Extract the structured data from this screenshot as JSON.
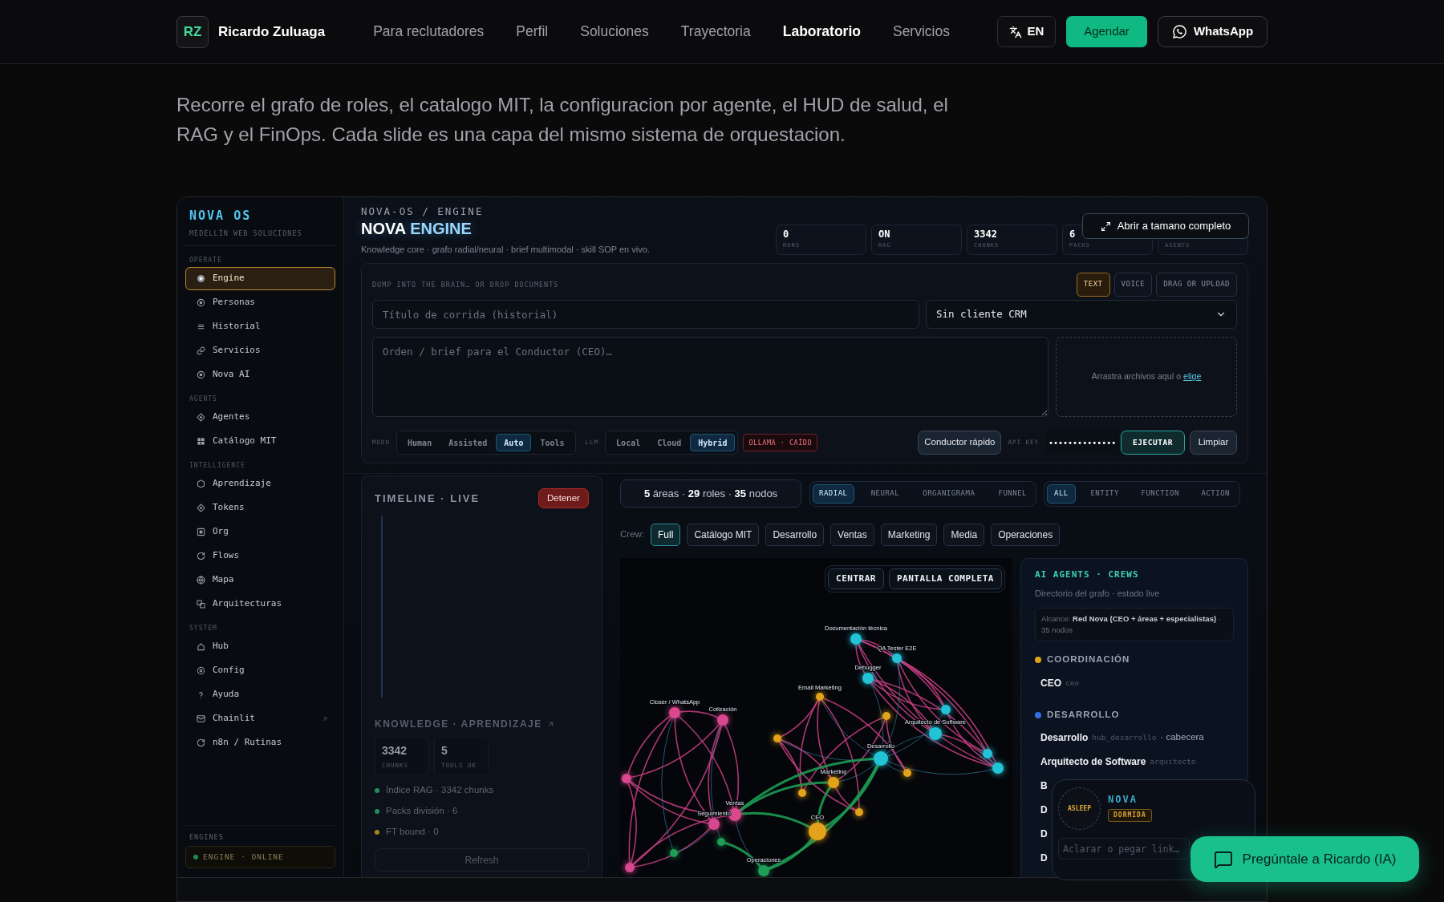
{
  "nav": {
    "initials": "RZ",
    "name": "Ricardo Zuluaga",
    "links": [
      {
        "label": "Para reclutadores",
        "selected": false
      },
      {
        "label": "Perfil",
        "selected": false
      },
      {
        "label": "Soluciones",
        "selected": false
      },
      {
        "label": "Trayectoria",
        "selected": false
      },
      {
        "label": "Laboratorio",
        "selected": true
      },
      {
        "label": "Servicios",
        "selected": false
      }
    ],
    "language": "EN",
    "cta": "Agendar",
    "whatsapp": "WhatsApp"
  },
  "intro": "Recorre el grafo de roles, el catalogo MIT, la configuracion por agente, el HUD de salud, el RAG y el FinOps. Cada slide es una capa del mismo sistema de orquestacion.",
  "expand_button": "Abrir a tamano completo",
  "sidebar": {
    "title": "NOVA OS",
    "subtitle": "MEDELLÍN WEB SOLUCIONES",
    "sections": [
      {
        "heading": "OPERATE",
        "items": [
          {
            "label": "Engine",
            "selected": true,
            "external": false
          },
          {
            "label": "Personas",
            "selected": false,
            "external": false
          },
          {
            "label": "Historial",
            "selected": false,
            "external": false
          },
          {
            "label": "Servicios",
            "selected": false,
            "external": false
          },
          {
            "label": "Nova AI",
            "selected": false,
            "external": false
          }
        ]
      },
      {
        "heading": "AGENTS",
        "items": [
          {
            "label": "Agentes",
            "selected": false,
            "external": false
          },
          {
            "label": "Catálogo MIT",
            "selected": false,
            "external": false
          }
        ]
      },
      {
        "heading": "INTELLIGENCE",
        "items": [
          {
            "label": "Aprendizaje",
            "selected": false,
            "external": false
          },
          {
            "label": "Tokens",
            "selected": false,
            "external": false
          },
          {
            "label": "Org",
            "selected": false,
            "external": false
          },
          {
            "label": "Flows",
            "selected": false,
            "external": false
          },
          {
            "label": "Mapa",
            "selected": false,
            "external": false
          },
          {
            "label": "Arquitecturas",
            "selected": false,
            "external": false
          }
        ]
      },
      {
        "heading": "SYSTEM",
        "items": [
          {
            "label": "Hub",
            "selected": false,
            "external": false
          },
          {
            "label": "Config",
            "selected": false,
            "external": false
          },
          {
            "label": "Ayuda",
            "selected": false,
            "external": false
          },
          {
            "label": "Chainlit",
            "selected": false,
            "external": true
          },
          {
            "label": "n8n / Rutinas",
            "selected": false,
            "external": false
          }
        ]
      }
    ],
    "footer": {
      "heading": "ENGINES",
      "status": "ENGINE · ONLINE"
    }
  },
  "engine": {
    "breadcrumb": "NOVA-OS / ENGINE",
    "title": "NOVA",
    "title_accent": "ENGINE",
    "subtitle": "Knowledge core · grafo radial/neural · brief multimodal · skill SOP en vivo.",
    "stats": [
      {
        "value": "0",
        "label": "RUNS"
      },
      {
        "value": "ON",
        "label": "RAG"
      },
      {
        "value": "3342",
        "label": "CHUNKS"
      },
      {
        "value": "6",
        "label": "PACKS"
      },
      {
        "label": "AGENTS"
      }
    ]
  },
  "composer": {
    "label": "DUMP INTO THE BRAIN… OR DROP DOCUMENTS",
    "input_modes": [
      {
        "label": "TEXT",
        "selected": true
      },
      {
        "label": "VOICE",
        "selected": false
      },
      {
        "label": "DRAG OR UPLOAD",
        "selected": false
      }
    ],
    "title_field": {
      "placeholder": "Título de corrida (historial)"
    },
    "client_select": {
      "value": "Sin cliente CRM"
    },
    "brief_field": {
      "placeholder": "Orden / brief para el Conductor (CEO)…"
    },
    "dropzone": {
      "text": "Arrastra archivos aquí o",
      "link": "elige"
    },
    "mode_label": "MODO",
    "modes": [
      {
        "label": "Human",
        "selected": false
      },
      {
        "label": "Assisted",
        "selected": false
      },
      {
        "label": "Auto",
        "selected": true
      },
      {
        "label": "Tools",
        "selected": false
      }
    ],
    "llm_label": "LLM",
    "llms": [
      {
        "label": "Local",
        "selected": false
      },
      {
        "label": "Cloud",
        "selected": false
      },
      {
        "label": "Hybrid",
        "selected": true
      }
    ],
    "llm_status": "OLLAMA · CAÍDO",
    "quick_button": "Conductor rápido",
    "api_key_label": "API KEY",
    "api_key_value": "••••••••••••••",
    "run_button": "EJECUTAR",
    "clear_button": "Limpiar"
  },
  "timeline": {
    "title": "TIMELINE · LIVE",
    "stop_button": "Detener"
  },
  "knowledge": {
    "title": "KNOWLEDGE · APRENDIZAJE",
    "stats": [
      {
        "value": "3342",
        "label": "CHUNKS"
      },
      {
        "value": "5",
        "label": "TOOLS OK"
      }
    ],
    "items": [
      {
        "text": "Índice RAG · 3342 chunks",
        "color": "#1f8f5f"
      },
      {
        "text": "Packs división · 6",
        "color": "#1f8f5f"
      },
      {
        "text": "FT bound · 0",
        "color": "#a8841f"
      }
    ],
    "refresh_button": "Refresh"
  },
  "graph": {
    "summary": "**5** áreas · **29** roles · **35** nodos",
    "views": [
      {
        "label": "RADIAL",
        "selected": true
      },
      {
        "label": "NEURAL",
        "selected": false
      },
      {
        "label": "ORGANIGRAMA",
        "selected": false
      },
      {
        "label": "FUNNEL",
        "selected": false
      }
    ],
    "filters": [
      {
        "label": "ALL",
        "selected": true
      },
      {
        "label": "ENTITY",
        "selected": false
      },
      {
        "label": "FUNCTION",
        "selected": false
      },
      {
        "label": "ACTION",
        "selected": false
      }
    ],
    "crew_label": "Crew:",
    "crews": [
      {
        "label": "Full",
        "selected": true
      },
      {
        "label": "Catálogo MIT",
        "selected": false
      },
      {
        "label": "Desarrollo",
        "selected": false
      },
      {
        "label": "Ventas",
        "selected": false
      },
      {
        "label": "Marketing",
        "selected": false
      },
      {
        "label": "Media",
        "selected": false
      },
      {
        "label": "Operaciones",
        "selected": false
      }
    ],
    "canvas_buttons": [
      "CENTRAR",
      "PANTALLA COMPLETA"
    ],
    "nodes": [
      {
        "label": "Documentación técnica",
        "color": "#22c3d6"
      },
      {
        "label": "QA Tester E2E",
        "color": "#22c3d6"
      },
      {
        "label": "Debugger",
        "color": "#22c3d6"
      },
      {
        "label": "Email Marketing",
        "color": "#e2a31a"
      },
      {
        "label": "Closer / WhatsApp",
        "color": "#d9478f"
      },
      {
        "label": "Cotización",
        "color": "#d9478f"
      },
      {
        "color": "#e2a31a"
      },
      {
        "color": "#22c3d6"
      },
      {
        "label": "Arquitecto de Software",
        "color": "#22c3d6"
      },
      {
        "color": "#e2a31a"
      },
      {
        "color": "#22c3d6"
      },
      {
        "color": "#22c3d6"
      },
      {
        "label": "Desarrollo",
        "color": "#22c3d6"
      },
      {
        "label": "Marketing",
        "color": "#e2a31a"
      },
      {
        "color": "#e2a31a"
      },
      {
        "color": "#e2a31a"
      },
      {
        "color": "#e2a31a"
      },
      {
        "label": "CEO",
        "color": "#e2a31a"
      },
      {
        "color": "#d9478f"
      },
      {
        "label": "Ventas",
        "color": "#d9478f"
      },
      {
        "label": "Seguimiento",
        "color": "#d9478f"
      },
      {
        "color": "#d9478f"
      },
      {
        "color": "#1f9d57"
      },
      {
        "color": "#1f9d57"
      },
      {
        "label": "Operaciones",
        "color": "#1f9d57"
      }
    ]
  },
  "crews_panel": {
    "title": "AI AGENTS · CREWS",
    "subtitle": "Directorio del grafo · estado live",
    "scope": "Alcance: **Red Nova (CEO + áreas + especialistas)** · 35 nodos",
    "groups": [
      {
        "name": "COORDINACIÓN",
        "color": "#e0a21b",
        "members": [
          {
            "name": "CEO",
            "slug": "ceo"
          }
        ]
      },
      {
        "name": "DESARROLLO",
        "color": "#2f6fe0",
        "members": [
          {
            "name": "Desarrollo",
            "slug": "hub_desarrollo",
            "note": "· cabecera"
          },
          {
            "name": "Arquitecto de Software",
            "slug": "arquitecto"
          },
          {
            "name": "B"
          },
          {
            "name": "D"
          },
          {
            "name": "D"
          },
          {
            "name": "D"
          }
        ]
      }
    ]
  },
  "nova_widget": {
    "ring": "ASLEEP",
    "name": "NOVA",
    "status": "DORMIDA",
    "input": {
      "placeholder": "Aclarar o pegar link…"
    }
  },
  "chat_button": "Pregúntale a Ricardo (IA)"
}
